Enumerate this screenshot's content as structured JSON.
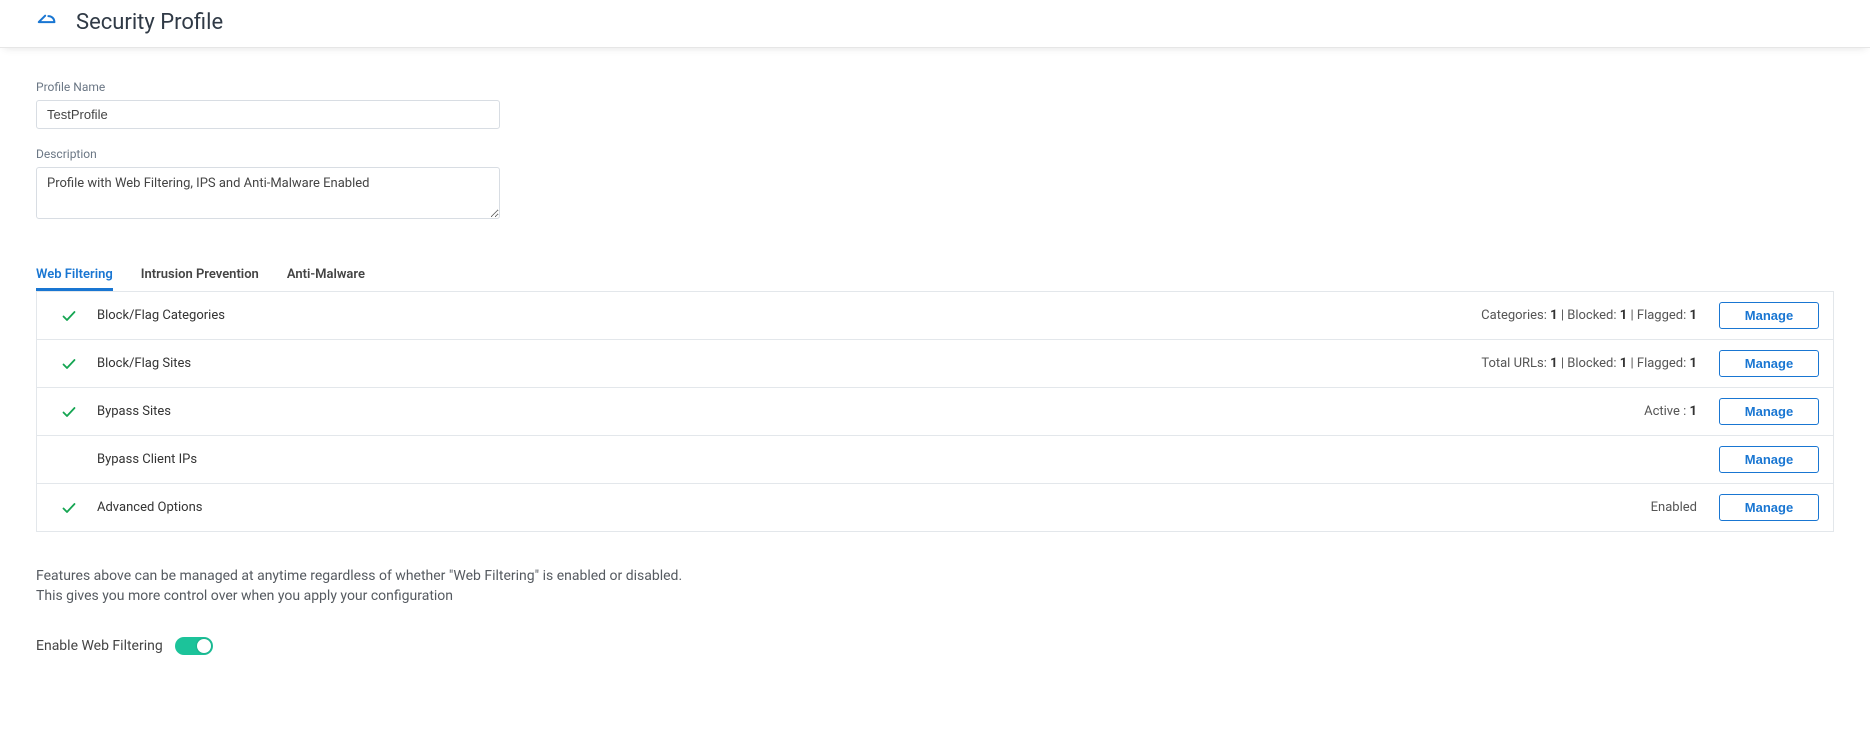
{
  "header": {
    "title": "Security Profile"
  },
  "form": {
    "profile_name_label": "Profile Name",
    "profile_name_value": "TestProfile",
    "description_label": "Description",
    "description_value": "Profile with Web Filtering, IPS and Anti-Malware Enabled"
  },
  "tabs": {
    "web_filtering": "Web Filtering",
    "intrusion_prevention": "Intrusion Prevention",
    "anti_malware": "Anti-Malware"
  },
  "rows": {
    "block_flag_categories": {
      "title": "Block/Flag Categories",
      "summary_label_categories": "Categories:",
      "summary_val_categories": "1",
      "summary_label_blocked": "Blocked:",
      "summary_val_blocked": "1",
      "summary_label_flagged": "Flagged:",
      "summary_val_flagged": "1",
      "manage": "Manage"
    },
    "block_flag_sites": {
      "title": "Block/Flag Sites",
      "summary_label_totalurls": "Total URLs:",
      "summary_val_totalurls": "1",
      "summary_label_blocked": "Blocked:",
      "summary_val_blocked": "1",
      "summary_label_flagged": "Flagged:",
      "summary_val_flagged": "1",
      "manage": "Manage"
    },
    "bypass_sites": {
      "title": "Bypass Sites",
      "summary_label_active": "Active :",
      "summary_val_active": "1",
      "manage": "Manage"
    },
    "bypass_client_ips": {
      "title": "Bypass Client IPs",
      "manage": "Manage"
    },
    "advanced_options": {
      "title": "Advanced Options",
      "summary_text": "Enabled",
      "manage": "Manage"
    }
  },
  "help": {
    "line1": "Features above can be managed at anytime regardless of whether \"Web Filtering\" is enabled or disabled.",
    "line2": "This gives you more control over when you apply your configuration"
  },
  "toggle": {
    "label": "Enable Web Filtering",
    "enabled": true
  }
}
